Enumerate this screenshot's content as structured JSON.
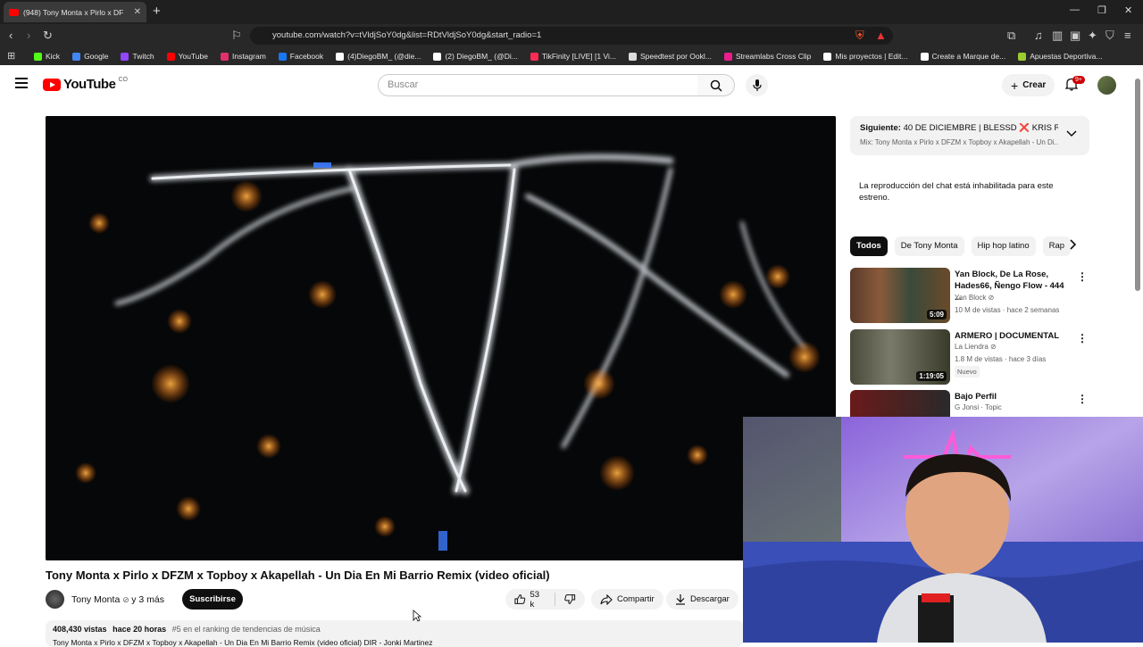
{
  "browser": {
    "tab_title": "(948) Tony Monta x Pirlo x DF",
    "url": "youtube.com/watch?v=tVldjSoY0dg&list=RDtVldjSoY0dg&start_radio=1",
    "bookmarks": [
      {
        "label": "Kick",
        "color": "#53fc18"
      },
      {
        "label": "Google",
        "color": "#4285f4"
      },
      {
        "label": "Twitch",
        "color": "#9146ff"
      },
      {
        "label": "YouTube",
        "color": "#ff0000"
      },
      {
        "label": "Instagram",
        "color": "#e1306c"
      },
      {
        "label": "Facebook",
        "color": "#1877f2"
      },
      {
        "label": "(4)DiegoBM_ (@die...",
        "color": "#ffffff"
      },
      {
        "label": "(2) DiegoBM_ (@Di...",
        "color": "#ffffff"
      },
      {
        "label": "TikFinity [LIVE] [1 Vi...",
        "color": "#fe2c55"
      },
      {
        "label": "Speedtest por Ookl...",
        "color": "#dddddd"
      },
      {
        "label": "Streamlabs Cross Clip",
        "color": "#e91e8c"
      },
      {
        "label": "Mis proyectos | Edit...",
        "color": "#ffffff"
      },
      {
        "label": "Create a Marque de...",
        "color": "#ffffff"
      },
      {
        "label": "Apuestas Deportiva...",
        "color": "#9acd32"
      }
    ]
  },
  "header": {
    "logo_text": "YouTube",
    "country": "CO",
    "search_placeholder": "Buscar",
    "create_label": "Crear",
    "notifications": "9+"
  },
  "video": {
    "title": "Tony Monta x Pirlo x DFZM x Topboy x Akapellah - Un Dia En Mi Barrio Remix (video oficial)",
    "channel": "Tony Monta",
    "channel_suffix": "y 3 más",
    "subscribe_label": "Suscribirse",
    "likes": "53 k",
    "share_label": "Compartir",
    "download_label": "Descargar",
    "views": "408,430 vistas",
    "uploaded": "hace 20 horas",
    "ranking": "#5 en el ranking de tendencias de música",
    "desc_line": "Tony Monta x Pirlo x DFZM x Topboy x Akapellah - Un Dia En Mi Barrio Remix (video oficial) DIR - Jonki Martinez"
  },
  "sidebar": {
    "up_next_label": "Siguiente:",
    "up_next_title": "40 DE DICIEMBRE | BLESSD ❌ KRIS R ...",
    "up_next_mix": "Mix: Tony Monta x Pirlo x DFZM x Topboy x Akapellah - Un Di...",
    "chat_disabled": "La reproducción del chat está inhabilitada para este estreno.",
    "chips": [
      "Todos",
      "De Tony Monta",
      "Hip hop latino",
      "Rap"
    ],
    "recommendations": [
      {
        "title": "Yan Block, De La Rose, Hades66, Ñengo Flow - 444 ...",
        "channel": "Yan Block",
        "meta": "10 M de vistas · hace 2 semanas",
        "duration": "5:09"
      },
      {
        "title": "ARMERO | DOCUMENTAL",
        "channel": "La Liendra",
        "meta": "1.8 M de vistas · hace 3 días",
        "duration": "1:19:05",
        "badge": "Nuevo"
      },
      {
        "title": "Bajo Perfil",
        "channel": "G Jonsi · Topic",
        "meta": "",
        "duration": ""
      }
    ]
  }
}
